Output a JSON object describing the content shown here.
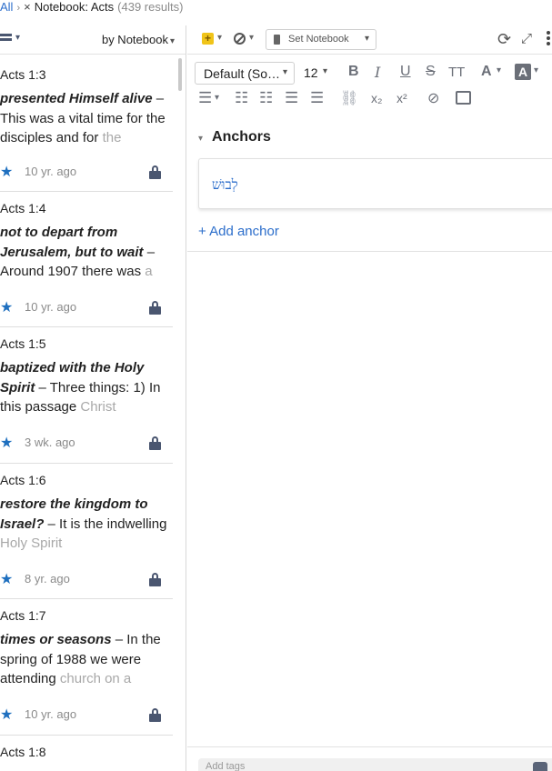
{
  "breadcrumb": {
    "root": "All",
    "separator": "›",
    "close": "×",
    "title": "Notebook: Acts",
    "count": "(439 results)"
  },
  "list": {
    "sort_label": "by Notebook",
    "notes": [
      {
        "ref": "Acts 1:3",
        "title": "presented Himself alive",
        "text": " – This was a vital time for the disciples and for ",
        "fade": "the",
        "age": "10 yr. ago",
        "starred": true,
        "locked": true
      },
      {
        "ref": "Acts 1:4",
        "title": "not to depart from Jerusalem, but to wait",
        "text": " – Around 1907 there was ",
        "fade": "a",
        "age": "10 yr. ago",
        "starred": true,
        "locked": true
      },
      {
        "ref": "Acts 1:5",
        "title": "baptized with the Holy Spirit",
        "text": " – Three things: 1) In this passage ",
        "fade": "Christ",
        "age": "3 wk. ago",
        "starred": true,
        "locked": true
      },
      {
        "ref": "Acts 1:6",
        "title": "restore the kingdom to Israel?",
        "text": " – It is the indwelling ",
        "fade": "Holy Spirit",
        "age": "8 yr. ago",
        "starred": true,
        "locked": true
      },
      {
        "ref": "Acts 1:7",
        "title": "times or seasons",
        "text": " – In the spring of 1988 we were attending ",
        "fade": "church on a",
        "age": "10 yr. ago",
        "starred": true,
        "locked": true
      },
      {
        "ref": "Acts 1:8",
        "title": "",
        "text": "",
        "fade": "",
        "age": "",
        "starred": false,
        "locked": false
      }
    ]
  },
  "toolbar": {
    "set_notebook": "Set Notebook",
    "font": "Default (So…",
    "size": "12",
    "bold": "B",
    "italic": "I",
    "underline": "U",
    "strike": "S",
    "case": "TT",
    "font_color": "A",
    "highlight": "A",
    "subscript": "x₂",
    "superscript": "x²"
  },
  "editor": {
    "anchors_heading": "Anchors",
    "anchor_text": "לְבוּשׁ",
    "add_anchor": "+ Add anchor",
    "tags_placeholder": "Add tags"
  },
  "colors": {
    "link": "#2c6ecb",
    "star": "#1e6fbf",
    "icon": "#4a5670",
    "add_note": "#f0c419"
  },
  "icons": {
    "star": "★",
    "chevron_down": "⌄",
    "sync": "⟳",
    "expand": "⤢",
    "plus": "+"
  }
}
